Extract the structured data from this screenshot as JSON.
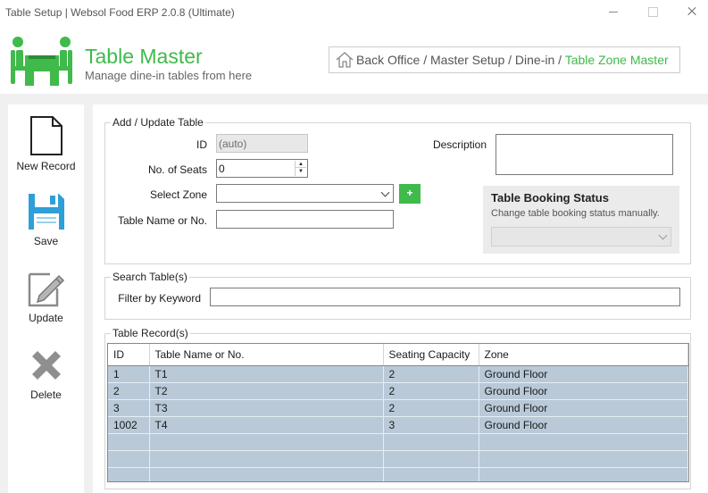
{
  "window": {
    "title": "Table Setup | Websol Food ERP 2.0.8 (Ultimate)"
  },
  "header": {
    "title": "Table Master",
    "subtitle": "Manage dine-in tables from here",
    "breadcrumb": {
      "path": "Back Office / Master Setup / Dine-in / ",
      "current": "Table Zone Master"
    }
  },
  "toolbar": {
    "new_record": "New Record",
    "save": "Save",
    "update": "Update",
    "delete": "Delete"
  },
  "form": {
    "group_label": "Add / Update Table",
    "id_label": "ID",
    "id_value": "(auto)",
    "seats_label": "No. of Seats",
    "seats_value": "0",
    "zone_label": "Select Zone",
    "zone_value": "",
    "add_zone": "+",
    "table_name_label": "Table Name or No.",
    "table_name_value": "",
    "description_label": "Description",
    "description_value": "",
    "booking": {
      "title": "Table Booking Status",
      "subtitle": "Change table booking status manually.",
      "value": ""
    }
  },
  "search": {
    "group_label": "Search Table(s)",
    "filter_label": "Filter by Keyword",
    "filter_value": ""
  },
  "records": {
    "group_label": "Table Record(s)",
    "columns": [
      "ID",
      "Table Name or No.",
      "Seating Capacity",
      "Zone"
    ],
    "rows": [
      [
        "1",
        "T1",
        "2",
        "Ground Floor"
      ],
      [
        "2",
        "T2",
        "2",
        "Ground Floor"
      ],
      [
        "3",
        "T3",
        "2",
        "Ground Floor"
      ],
      [
        "1002",
        "T4",
        "3",
        "Ground Floor"
      ]
    ]
  },
  "colors": {
    "accent": "#3fba4b",
    "grid_row": "#b9c9d8"
  }
}
